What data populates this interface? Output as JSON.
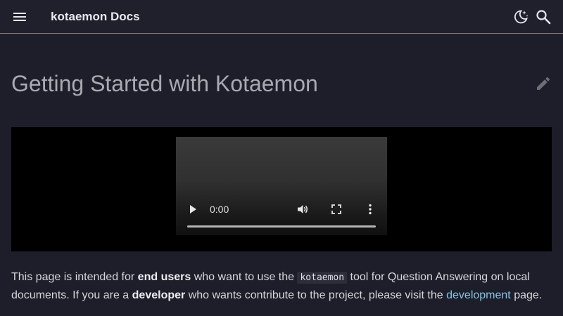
{
  "header": {
    "site_title": "kotaemon Docs",
    "icons": {
      "menu": "menu-icon",
      "theme": "theme-moon-icon",
      "search": "search-icon"
    }
  },
  "page": {
    "title": "Getting Started with Kotaemon",
    "edit_icon": "edit-pencil-icon"
  },
  "video": {
    "current_time": "0:00",
    "progress": 0,
    "icons": {
      "play": "play-icon",
      "volume": "volume-icon",
      "fullscreen": "fullscreen-icon",
      "more": "more-vertical-icon"
    }
  },
  "intro": {
    "t1": "This page is intended for ",
    "b1": "end users",
    "t2": " who want to use the ",
    "code": "kotaemon",
    "t3": " tool for Question Answering on local documents. If you are a ",
    "b2": "developer",
    "t4": " who wants contribute to the project, please visit the ",
    "link": "development",
    "t5": " page."
  },
  "colors": {
    "background": "#1e1e2a",
    "header_border": "#8b6fc8",
    "link": "#7ec8e6"
  }
}
